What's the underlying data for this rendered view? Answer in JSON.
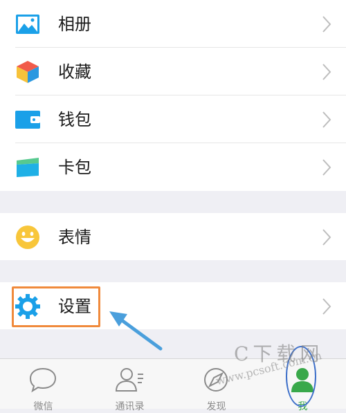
{
  "list": {
    "group1": [
      {
        "name": "photos",
        "label": "相册",
        "icon": "photos-icon"
      },
      {
        "name": "favorites",
        "label": "收藏",
        "icon": "favorites-cube-icon"
      },
      {
        "name": "wallet",
        "label": "钱包",
        "icon": "wallet-icon"
      },
      {
        "name": "cards",
        "label": "卡包",
        "icon": "card-icon"
      }
    ],
    "group2": [
      {
        "name": "stickers",
        "label": "表情",
        "icon": "smiley-icon"
      }
    ],
    "group3": [
      {
        "name": "settings",
        "label": "设置",
        "icon": "gear-icon"
      }
    ]
  },
  "tabs": [
    {
      "name": "chats",
      "label": "微信",
      "icon": "chat-bubble-icon"
    },
    {
      "name": "contacts",
      "label": "通讯录",
      "icon": "contacts-icon"
    },
    {
      "name": "discover",
      "label": "发现",
      "icon": "compass-icon"
    },
    {
      "name": "me",
      "label": "我",
      "icon": "me-avatar-icon"
    }
  ],
  "watermark": {
    "brand": "C下载网",
    "url": "www.pcsoft.com.cn"
  },
  "colors": {
    "background": "#efeff4",
    "highlight_border": "#f08a3c",
    "arrow": "#4a9fdc",
    "accent_blue": "#1aa0e8"
  }
}
